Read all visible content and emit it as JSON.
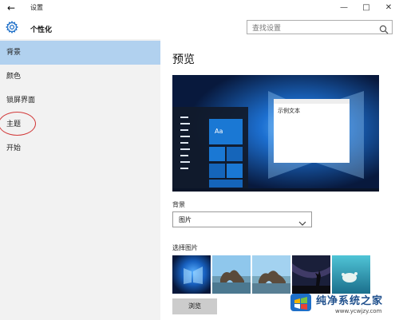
{
  "window": {
    "title": "设置",
    "back_icon": "back-arrow-icon",
    "controls": [
      "minimize-icon",
      "maximize-icon",
      "close-icon"
    ]
  },
  "header": {
    "title": "个性化",
    "icon": "gear-icon",
    "search_placeholder": "查找设置"
  },
  "sidebar": {
    "items": [
      {
        "label": "背景",
        "selected": true
      },
      {
        "label": "颜色",
        "selected": false
      },
      {
        "label": "锁屏界面",
        "selected": false
      },
      {
        "label": "主题",
        "selected": false,
        "circled": true
      },
      {
        "label": "开始",
        "selected": false
      }
    ]
  },
  "main": {
    "preview_title": "预览",
    "preview_sample_text": "示例文本",
    "preview_tile_text": "Aa",
    "background_label": "背景",
    "background_value": "图片",
    "choose_picture_label": "选择图片",
    "browse_label": "浏览",
    "thumbnails": [
      "windows-10-hero",
      "rock-arch-beach",
      "rock-arch-beach-2",
      "night-sky-tree",
      "underwater-turtle"
    ]
  },
  "watermark": {
    "title": "纯净系统之家",
    "url": "www.ycwjzy.com"
  },
  "colors": {
    "accent": "#1e6fc8",
    "selected_bg": "#b1d1ef",
    "sidebar_bg": "#f2f2f2",
    "highlight_circle": "#d23b3b",
    "button_bg": "#cccccc"
  }
}
